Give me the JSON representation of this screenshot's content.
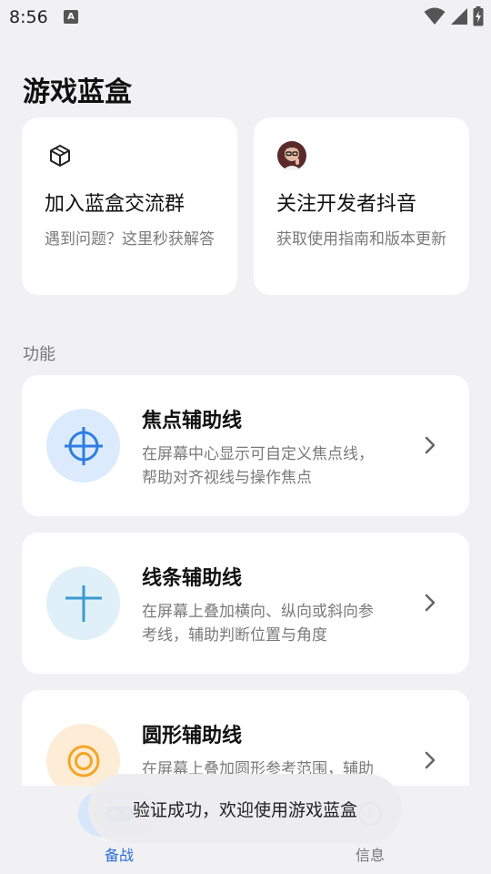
{
  "status_bar": {
    "time": "8:56",
    "icons": [
      "accessibility-a-icon",
      "wifi-icon",
      "signal-icon",
      "battery-charging-icon"
    ]
  },
  "page": {
    "title": "游戏蓝盒"
  },
  "top_cards": [
    {
      "icon": "cube-icon",
      "title": "加入蓝盒交流群",
      "subtitle": "遇到问题？这里秒获解答"
    },
    {
      "icon": "developer-avatar",
      "title": "关注开发者抖音",
      "subtitle": "获取使用指南和版本更新"
    }
  ],
  "section": {
    "label": "功能"
  },
  "features": [
    {
      "icon": "crosshair-icon",
      "title": "焦点辅助线",
      "desc": "在屏幕中心显示可自定义焦点线，帮助对齐视线与操作焦点",
      "accent": "#2f7de1",
      "circle_bg": "#dbeafc"
    },
    {
      "icon": "cross-lines-icon",
      "title": "线条辅助线",
      "desc": "在屏幕上叠加横向、纵向或斜向参考线，辅助判断位置与角度",
      "accent": "#3a9bd0",
      "circle_bg": "#dff0f9"
    },
    {
      "icon": "ring-icon",
      "title": "圆形辅助线",
      "desc": "在屏幕上叠加圆形参考范围，辅助",
      "accent": "#f5a524",
      "circle_bg": "#fdecd6"
    }
  ],
  "bottom_nav": {
    "tabs": [
      {
        "label": "备战",
        "active": true
      },
      {
        "label": "信息",
        "active": false
      }
    ]
  },
  "toast": {
    "text": "验证成功，欢迎使用游戏蓝盒"
  },
  "colors": {
    "background": "#f1f1f3",
    "card": "#ffffff",
    "nav_active": "#2f6ed8"
  }
}
